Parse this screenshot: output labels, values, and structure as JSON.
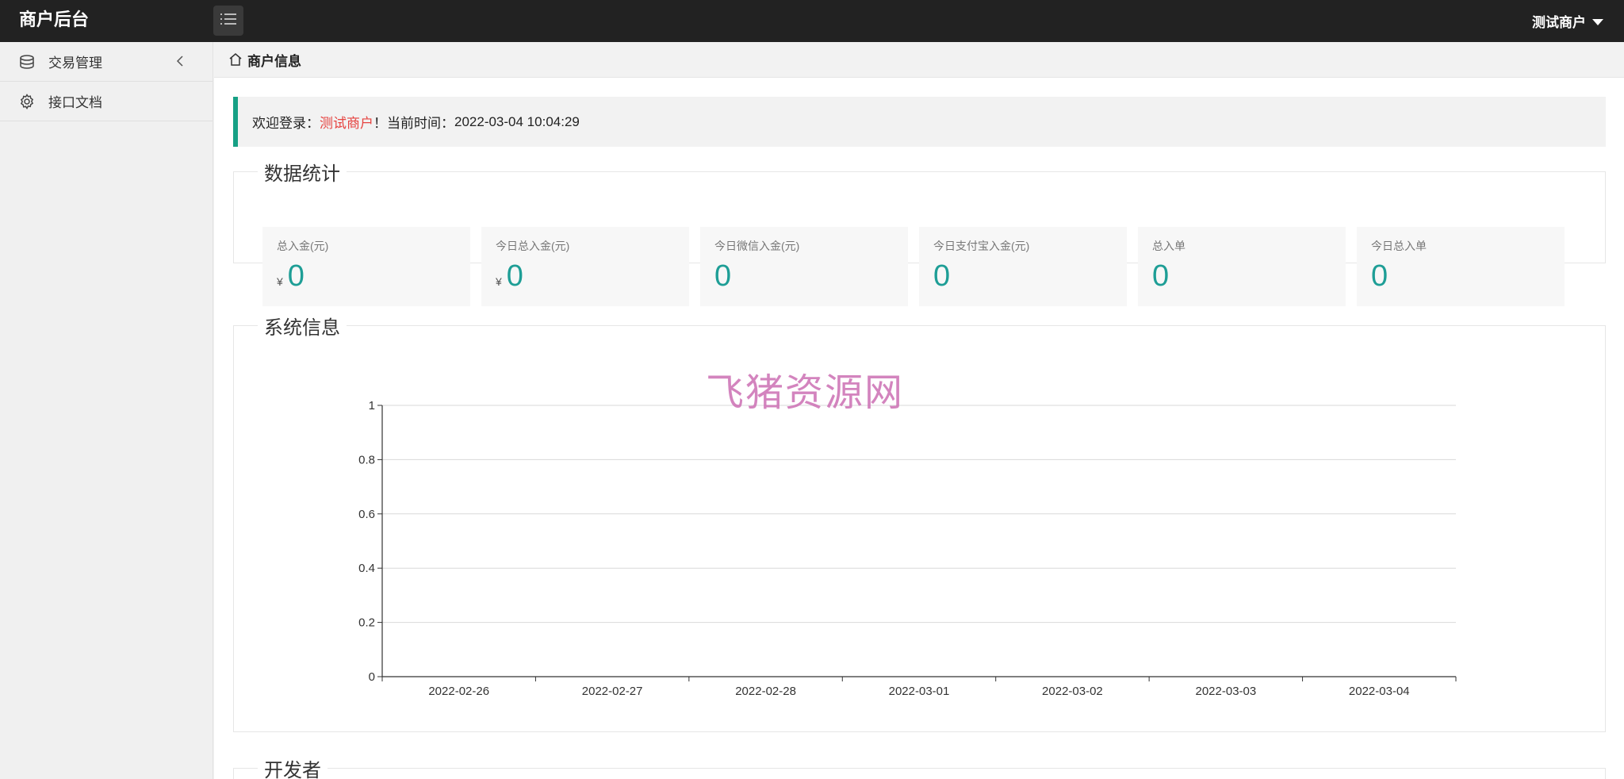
{
  "header": {
    "logo": "商户后台",
    "user": "测试商户",
    "menu_toggle_icon": "list-icon"
  },
  "sidebar": {
    "items": [
      {
        "label": "交易管理",
        "icon": "database-icon",
        "expandable": true
      },
      {
        "label": "接口文档",
        "icon": "gear-icon",
        "expandable": false
      }
    ]
  },
  "breadcrumb": {
    "icon": "home-icon",
    "label": "商户信息"
  },
  "welcome": {
    "prefix": "欢迎登录：",
    "name": "测试商户",
    "middle": "！当前时间：",
    "time": "2022-03-04 10:04:29"
  },
  "stats": {
    "title": "数据统计",
    "cards": [
      {
        "label": "总入金(元)",
        "currency": "¥",
        "value": "0"
      },
      {
        "label": "今日总入金(元)",
        "currency": "¥",
        "value": "0"
      },
      {
        "label": "今日微信入金(元)",
        "currency": "",
        "value": "0"
      },
      {
        "label": "今日支付宝入金(元)",
        "currency": "",
        "value": "0"
      },
      {
        "label": "总入单",
        "currency": "",
        "value": "0"
      },
      {
        "label": "今日总入单",
        "currency": "",
        "value": "0"
      }
    ]
  },
  "system_info": {
    "title": "系统信息",
    "watermark": "飞猪资源网"
  },
  "developer": {
    "title": "开发者"
  },
  "chart_data": {
    "type": "line",
    "x": [
      "2022-02-26",
      "2022-02-27",
      "2022-02-28",
      "2022-03-01",
      "2022-03-02",
      "2022-03-03",
      "2022-03-04"
    ],
    "y_ticks": [
      "0",
      "0.2",
      "0.4",
      "0.6",
      "0.8",
      "1"
    ],
    "ylim": [
      0,
      1
    ],
    "series": [],
    "grid": true,
    "title": "",
    "xlabel": "",
    "ylabel": ""
  }
}
